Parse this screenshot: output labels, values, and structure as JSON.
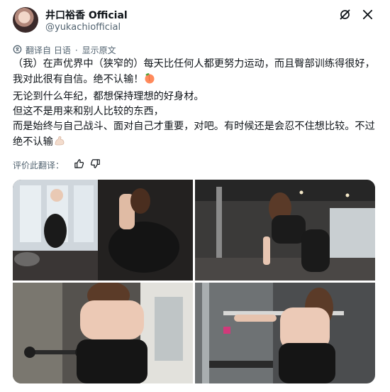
{
  "header": {
    "name": "井口裕香 Official",
    "handle": "@yukachiofficial",
    "icons": [
      "grok-icon",
      "close-icon"
    ]
  },
  "translation": {
    "label": "翻译自 日语",
    "separator": "·",
    "action": "显示原文"
  },
  "post": {
    "lines": [
      "（我）在声优界中（狭窄的）每天比任何人都更努力运动，而且臀部训练得很好，我对此很有自信。绝不认输！",
      "无论到什么年纪，都想保持理想的好身材。",
      "但这不是用来和别人比较的东西，",
      "而是始终与自己战斗、面对自己才重要，对吧。有时候还是会忍不住想比较。不过绝不认输"
    ],
    "emojis": [
      "peach-emoji",
      "flexed-biceps-emoji"
    ]
  },
  "rating": {
    "label": "评价此翻译：",
    "icons": [
      "thumbs-up-icon",
      "thumbs-down-icon"
    ]
  },
  "media": {
    "photos": [
      "gym-photo-1",
      "gym-photo-2",
      "gym-photo-3",
      "gym-photo-4"
    ]
  },
  "colors": {
    "text": "#0f1419",
    "secondary": "#536471",
    "link": "#536471",
    "accent": "#1d9bf0"
  }
}
